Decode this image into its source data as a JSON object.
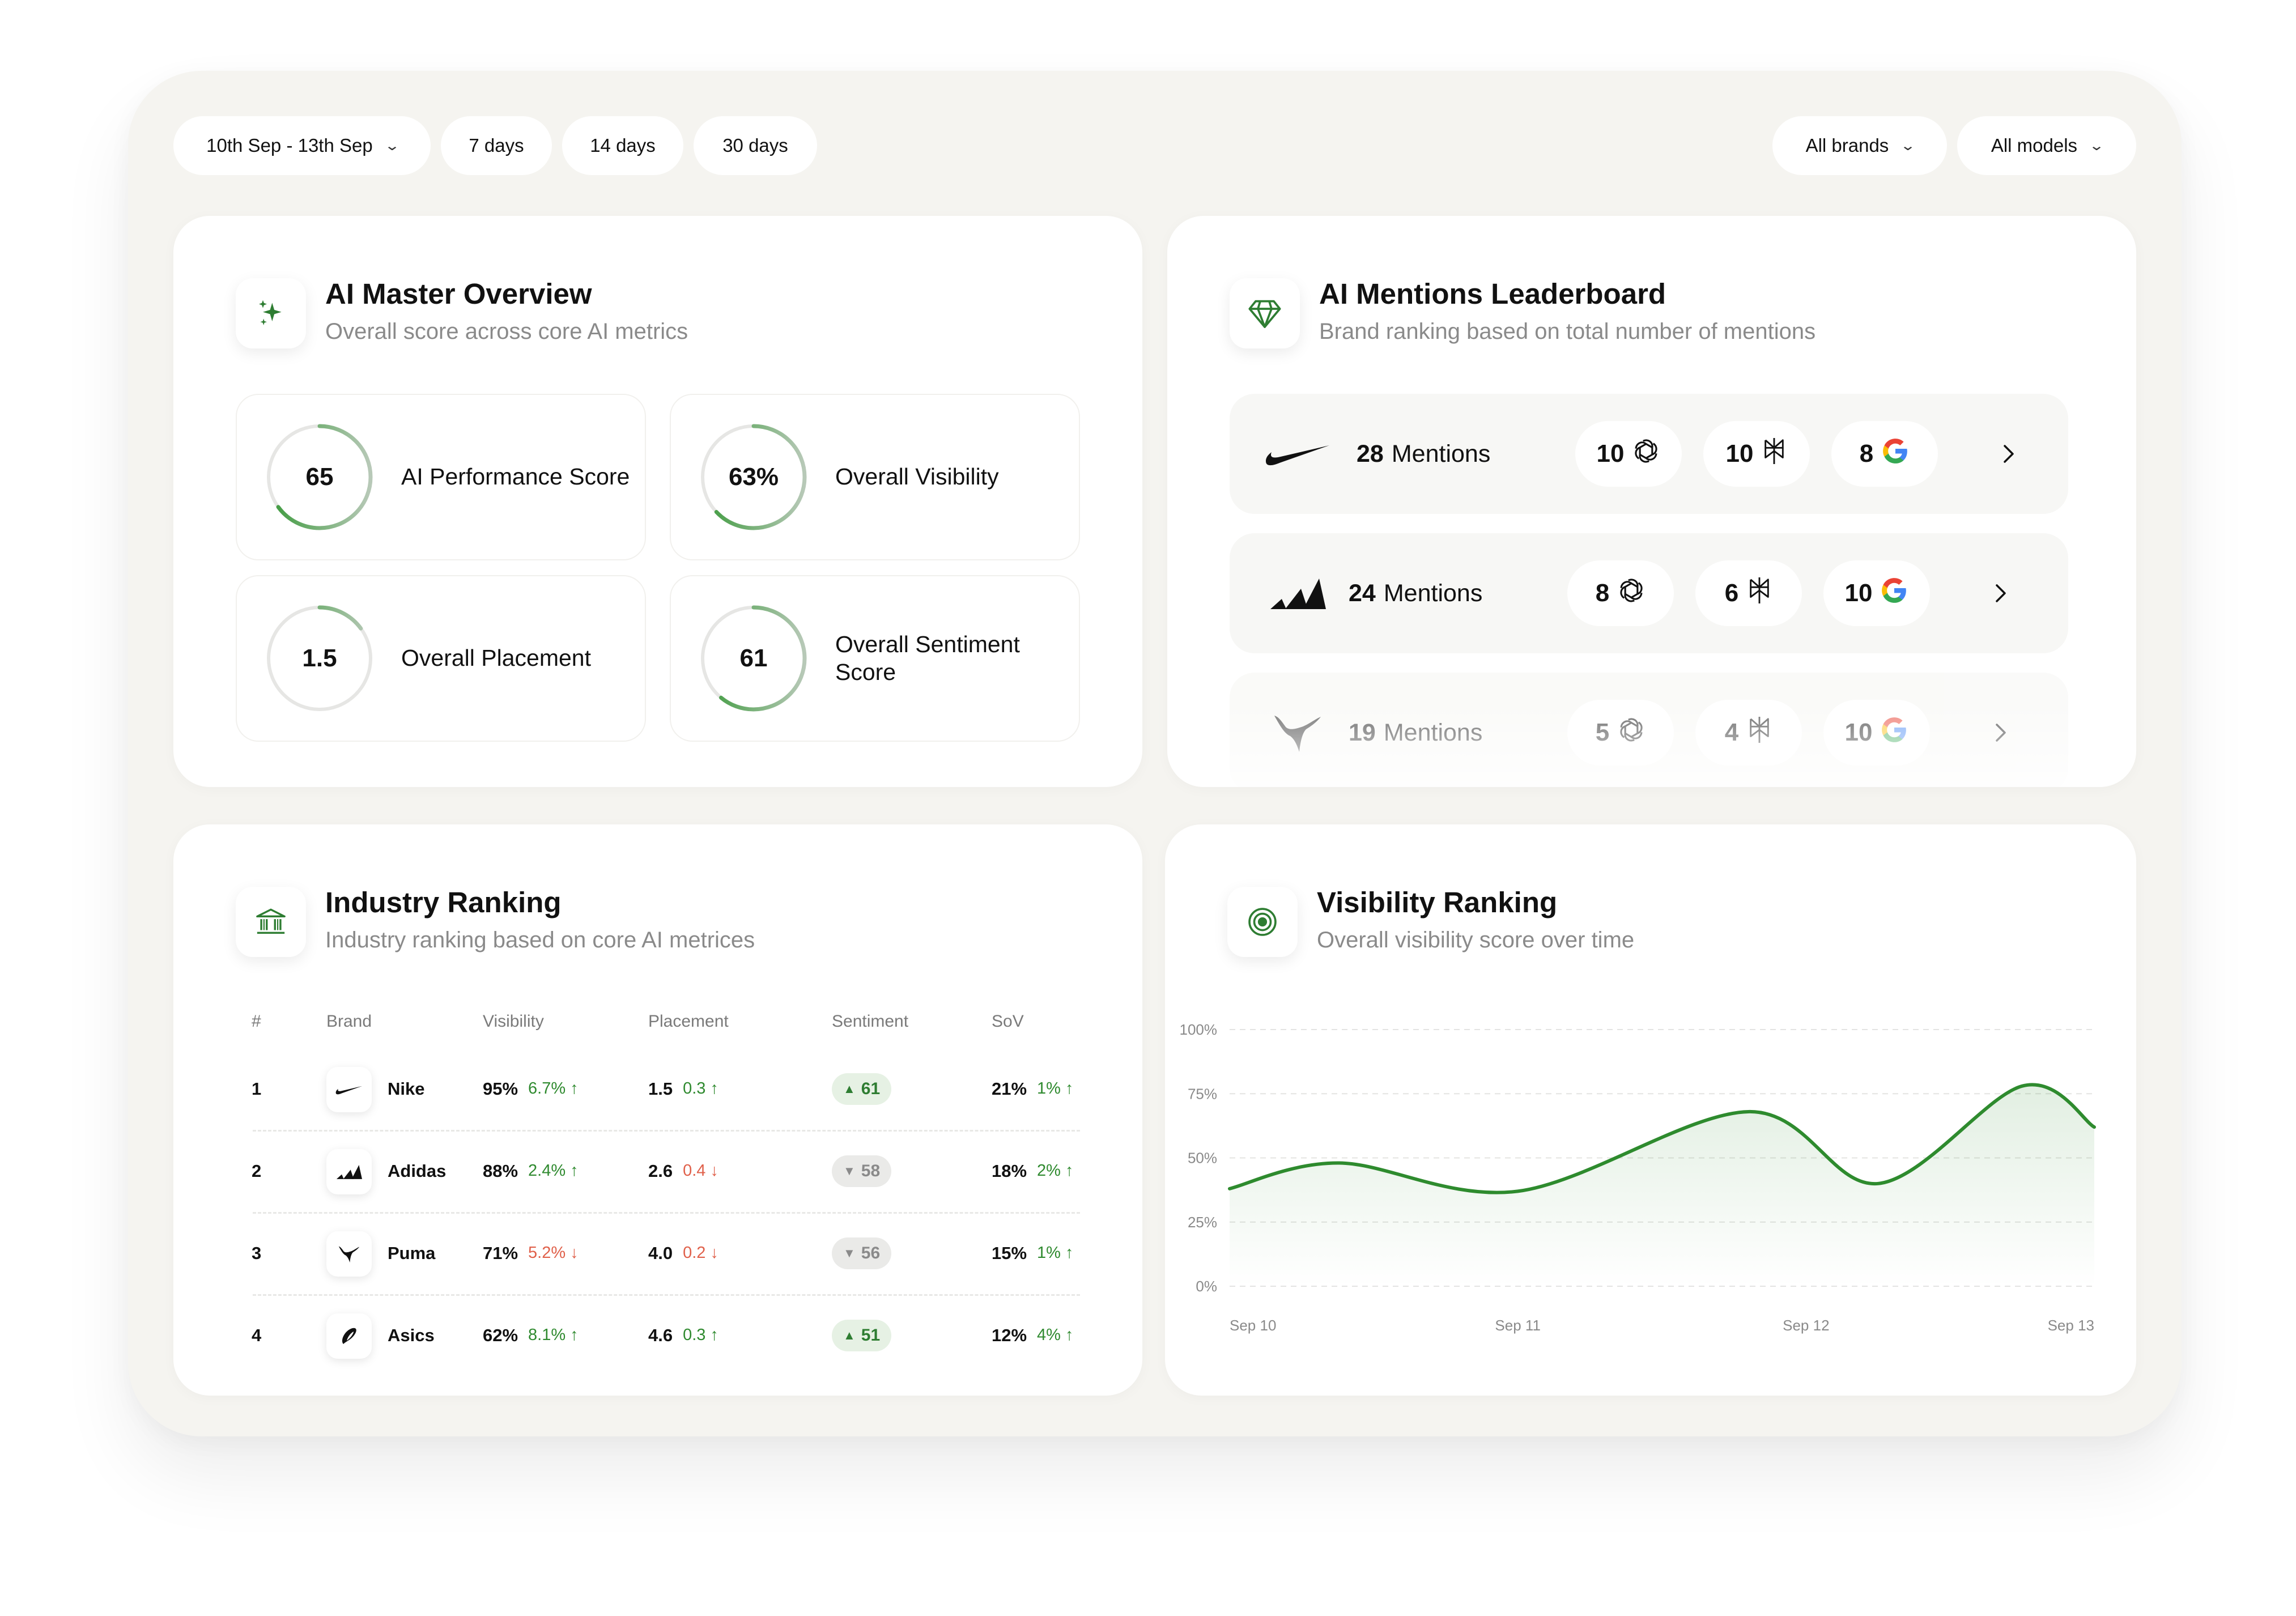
{
  "filters": {
    "date_range": "10th Sep - 13th Sep",
    "presets": [
      "7 days",
      "14 days",
      "30 days"
    ],
    "brands": "All brands",
    "models": "All models"
  },
  "overview": {
    "title": "AI Master Overview",
    "subtitle": "Overall score across core AI metrics",
    "icon": "sparkles-icon",
    "metrics": [
      {
        "value": "65",
        "label": "AI Performance Score",
        "progress": 0.65
      },
      {
        "value": "63%",
        "label": "Overall Visibility",
        "progress": 0.63
      },
      {
        "value": "1.5",
        "label": "Overall Placement",
        "progress": 0.15
      },
      {
        "value": "61",
        "label": "Overall Sentiment Score",
        "progress": 0.61
      }
    ]
  },
  "leaderboard": {
    "title": "AI Mentions Leaderboard",
    "subtitle": "Brand ranking based on total number of mentions",
    "icon": "diamond-icon",
    "mentions_suffix": "Mentions",
    "rows": [
      {
        "brand": "Nike",
        "mentions": "28",
        "chatgpt": "10",
        "perplexity": "10",
        "google": "8"
      },
      {
        "brand": "Adidas",
        "mentions": "24",
        "chatgpt": "8",
        "perplexity": "6",
        "google": "10"
      },
      {
        "brand": "Puma",
        "mentions": "19",
        "chatgpt": "5",
        "perplexity": "4",
        "google": "10"
      }
    ]
  },
  "ranking": {
    "title": "Industry Ranking",
    "subtitle": "Industry ranking based on core AI metrices",
    "icon": "bank-icon",
    "columns": [
      "#",
      "Brand",
      "Visibility",
      "Placement",
      "Sentiment",
      "SoV"
    ],
    "rows": [
      {
        "rank": "1",
        "brand": "Nike",
        "visibility": "95%",
        "visibility_delta": "6.7%",
        "visibility_dir": "up",
        "placement": "1.5",
        "placement_delta": "0.3",
        "placement_dir": "up",
        "sentiment": "61",
        "sentiment_dir": "up",
        "sov": "21%",
        "sov_delta": "1%",
        "sov_dir": "up"
      },
      {
        "rank": "2",
        "brand": "Adidas",
        "visibility": "88%",
        "visibility_delta": "2.4%",
        "visibility_dir": "up",
        "placement": "2.6",
        "placement_delta": "0.4",
        "placement_dir": "down",
        "sentiment": "58",
        "sentiment_dir": "down",
        "sov": "18%",
        "sov_delta": "2%",
        "sov_dir": "up"
      },
      {
        "rank": "3",
        "brand": "Puma",
        "visibility": "71%",
        "visibility_delta": "5.2%",
        "visibility_dir": "down",
        "placement": "4.0",
        "placement_delta": "0.2",
        "placement_dir": "down",
        "sentiment": "56",
        "sentiment_dir": "down",
        "sov": "15%",
        "sov_delta": "1%",
        "sov_dir": "up"
      },
      {
        "rank": "4",
        "brand": "Asics",
        "visibility": "62%",
        "visibility_delta": "8.1%",
        "visibility_dir": "up",
        "placement": "4.6",
        "placement_delta": "0.3",
        "placement_dir": "up",
        "sentiment": "51",
        "sentiment_dir": "up",
        "sov": "12%",
        "sov_delta": "4%",
        "sov_dir": "up"
      }
    ]
  },
  "visibility": {
    "title": "Visibility Ranking",
    "subtitle": "Overall visibility score over time",
    "icon": "target-icon",
    "colors": {
      "line": "#2e8b2e",
      "grid": "#e4e4e2"
    },
    "chart_data": {
      "type": "area",
      "x": [
        "Sep 10",
        "Sep 11",
        "Sep 12",
        "Sep 13"
      ],
      "y_ticks": [
        "100%",
        "75%",
        "50%",
        "25%",
        "0%"
      ],
      "ylim": [
        0,
        100
      ],
      "grid": true,
      "series": [
        {
          "values": [
            [
              0,
              38
            ],
            [
              0.38,
              48
            ],
            [
              1.0,
              37
            ],
            [
              1.8,
              68
            ],
            [
              2.25,
              40
            ],
            [
              2.75,
              78
            ],
            [
              3.0,
              62
            ]
          ]
        }
      ]
    }
  }
}
